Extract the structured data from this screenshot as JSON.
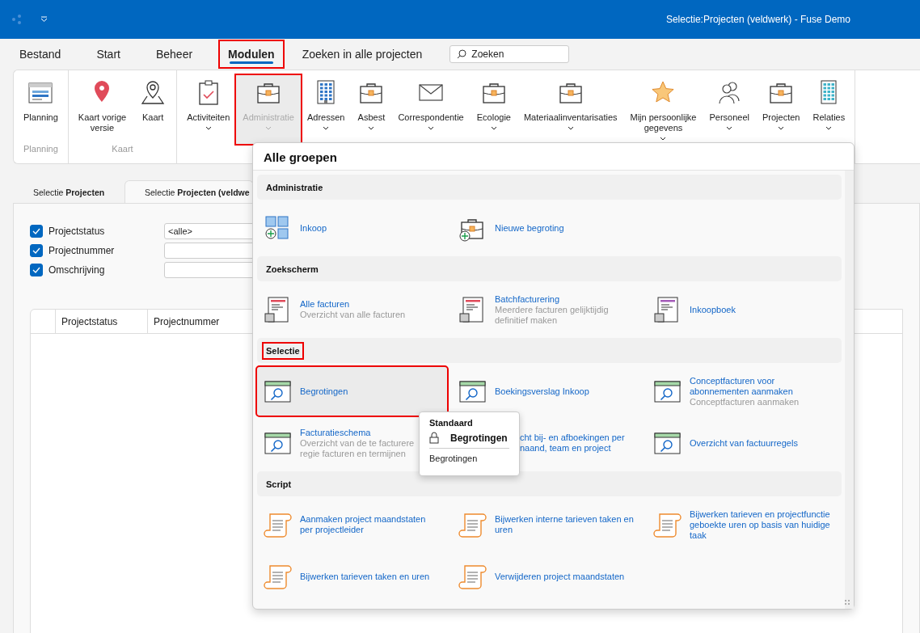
{
  "window": {
    "title": "Selectie:Projecten (veldwerk) - Fuse Demo"
  },
  "menu_tabs": [
    {
      "label": "Bestand",
      "selected": false,
      "highlighted": false
    },
    {
      "label": "Start",
      "selected": false,
      "highlighted": false
    },
    {
      "label": "Beheer",
      "selected": false,
      "highlighted": false
    },
    {
      "label": "Modulen",
      "selected": true,
      "highlighted": true
    },
    {
      "label": "Zoeken in alle projecten",
      "selected": false,
      "highlighted": false
    }
  ],
  "search": {
    "placeholder": "Zoeken"
  },
  "ribbon": {
    "groups": [
      {
        "label": "Planning",
        "items": [
          {
            "label": "Planning",
            "kind": "calendar",
            "dropdown": false,
            "disabled": false,
            "highlighted": false
          }
        ]
      },
      {
        "label": "Kaart",
        "items": [
          {
            "label": "Kaart vorige\nversie",
            "kind": "pin",
            "dropdown": false,
            "disabled": false,
            "highlighted": false
          },
          {
            "label": "Kaart",
            "kind": "map",
            "dropdown": false,
            "disabled": false,
            "highlighted": false
          }
        ]
      },
      {
        "items": [
          {
            "label": "Activiteiten",
            "kind": "clipboard",
            "dropdown": true,
            "disabled": false,
            "highlighted": false
          },
          {
            "label": "Administratie",
            "kind": "briefcase",
            "dropdown": true,
            "disabled": true,
            "highlighted": true
          },
          {
            "label": "Adressen",
            "kind": "building",
            "dropdown": true,
            "disabled": false,
            "highlighted": false
          },
          {
            "label": "Asbest",
            "kind": "briefcase",
            "dropdown": true,
            "disabled": false,
            "highlighted": false
          },
          {
            "label": "Correspondentie",
            "kind": "envelope",
            "dropdown": true,
            "disabled": false,
            "highlighted": false
          },
          {
            "label": "Ecologie",
            "kind": "briefcase",
            "dropdown": true,
            "disabled": false,
            "highlighted": false
          },
          {
            "label": "Materiaalinventarisaties",
            "kind": "briefcase",
            "dropdown": true,
            "disabled": false,
            "highlighted": false
          },
          {
            "label": "Mijn persoonlijke\ngegevens",
            "kind": "star",
            "dropdown": true,
            "disabled": false,
            "highlighted": false
          },
          {
            "label": "Personeel",
            "kind": "people",
            "dropdown": true,
            "disabled": false,
            "highlighted": false
          },
          {
            "label": "Projecten",
            "kind": "briefcase",
            "dropdown": true,
            "disabled": false,
            "highlighted": false
          },
          {
            "label": "Relaties",
            "kind": "tower",
            "dropdown": true,
            "disabled": false,
            "highlighted": false
          }
        ]
      }
    ]
  },
  "page_tabs": [
    {
      "label": "Selectie **Projecten**",
      "selected": false
    },
    {
      "label": "Selectie **Projecten (veldwe**",
      "selected": true
    }
  ],
  "filters": [
    {
      "label": "Projectstatus",
      "checked": true,
      "value": "<alle>"
    },
    {
      "label": "Projectnummer",
      "checked": true
    },
    {
      "label": "Omschrijving",
      "checked": true
    }
  ],
  "table": {
    "columns": [
      "Projectstatus",
      "Projectnummer"
    ]
  },
  "popup": {
    "title": "Alle groepen",
    "sections": [
      {
        "title": "Administratie",
        "highlighted": false,
        "items": [
          {
            "kind": "grid-add",
            "title": "Inkoop",
            "selected": false,
            "highlighted": false
          },
          {
            "kind": "briefcase-add",
            "title": "Nieuwe begroting",
            "selected": false,
            "highlighted": false
          }
        ]
      },
      {
        "title": "Zoekscherm",
        "highlighted": false,
        "items": [
          {
            "kind": "invoice-red",
            "title": "Alle facturen",
            "subtitle": "Overzicht van alle facturen",
            "selected": false,
            "highlighted": false
          },
          {
            "kind": "invoice-red",
            "title": "Batchfacturering",
            "subtitle": "Meerdere facturen gelijktijdig definitief maken",
            "selected": false,
            "highlighted": false
          },
          {
            "kind": "invoice-purple",
            "title": "Inkoopboek",
            "selected": false,
            "highlighted": false
          }
        ]
      },
      {
        "title": "Selectie",
        "highlighted": true,
        "items": [
          {
            "kind": "search-window",
            "title": "Begrotingen",
            "selected": true,
            "highlighted": true
          },
          {
            "kind": "search-window",
            "title": "Boekingsverslag Inkoop",
            "selected": false,
            "highlighted": false
          },
          {
            "kind": "search-window",
            "title": "Conceptfacturen voor abonnementen aanmaken",
            "subtitle": "Conceptfacturen aanmaken",
            "selected": false,
            "highlighted": false
          },
          {
            "kind": "search-window",
            "title": "Facturatieschema",
            "subtitle": "Overzicht van de te facturere\nregie facturen en termijnen",
            "selected": false,
            "highlighted": false
          },
          {
            "title": "cht bij- en afboekingen per\nnaand, team en project",
            "covered": true,
            "selected": false,
            "highlighted": false
          },
          {
            "kind": "search-window",
            "title": "Overzicht van factuurregels",
            "selected": false,
            "highlighted": false
          }
        ]
      },
      {
        "title": "Script",
        "highlighted": false,
        "items": [
          {
            "kind": "scroll",
            "title": "Aanmaken project maandstaten per projectleider",
            "selected": false,
            "highlighted": false
          },
          {
            "kind": "scroll",
            "title": "Bijwerken interne tarieven taken en uren",
            "selected": false,
            "highlighted": false
          },
          {
            "kind": "scroll",
            "title": "Bijwerken tarieven en projectfunctie geboekte uren op basis van huidige taak",
            "selected": false,
            "highlighted": false
          },
          {
            "kind": "scroll",
            "title": "Bijwerken tarieven taken en uren",
            "selected": false,
            "highlighted": false
          },
          {
            "kind": "scroll",
            "title": "Verwijderen project maandstaten",
            "selected": false,
            "highlighted": false
          }
        ]
      }
    ]
  },
  "tooltip": {
    "heading": "Standaard",
    "title": "Begrotingen",
    "footer": "Begrotingen"
  }
}
